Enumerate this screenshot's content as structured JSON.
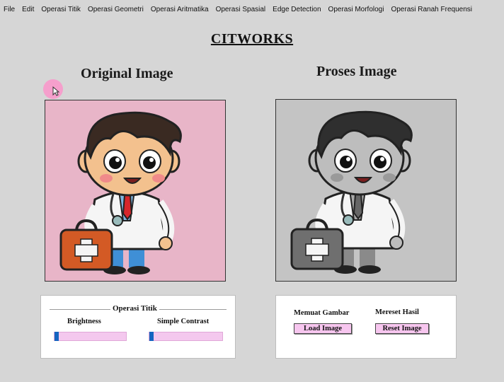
{
  "menu": [
    "File",
    "Edit",
    "Operasi Titik",
    "Operasi Geometri",
    "Operasi Aritmatika",
    "Operasi Spasial",
    "Edge Detection",
    "Operasi Morfologi",
    "Operasi Ranah Frequensi"
  ],
  "app_title": "CITWORKS",
  "original": {
    "title": "Original Image",
    "bg_color": "#e8b5c8"
  },
  "processed": {
    "title": "Proses Image",
    "bg_color": "#c4c4c4"
  },
  "operasi_titik": {
    "group_label": "Operasi Titik",
    "brightness_label": "Brightness",
    "brightness_value": 0,
    "contrast_label": "Simple Contrast",
    "contrast_value": 0
  },
  "controls": {
    "load_label": "Memuat Gambar",
    "load_button": "Load Image",
    "reset_label": "Mereset Hasil",
    "reset_button": "Reset Image"
  },
  "colors": {
    "slider_track": "#f4c8ee",
    "slider_thumb": "#1565c0",
    "button_bg": "#f7c6ef"
  }
}
